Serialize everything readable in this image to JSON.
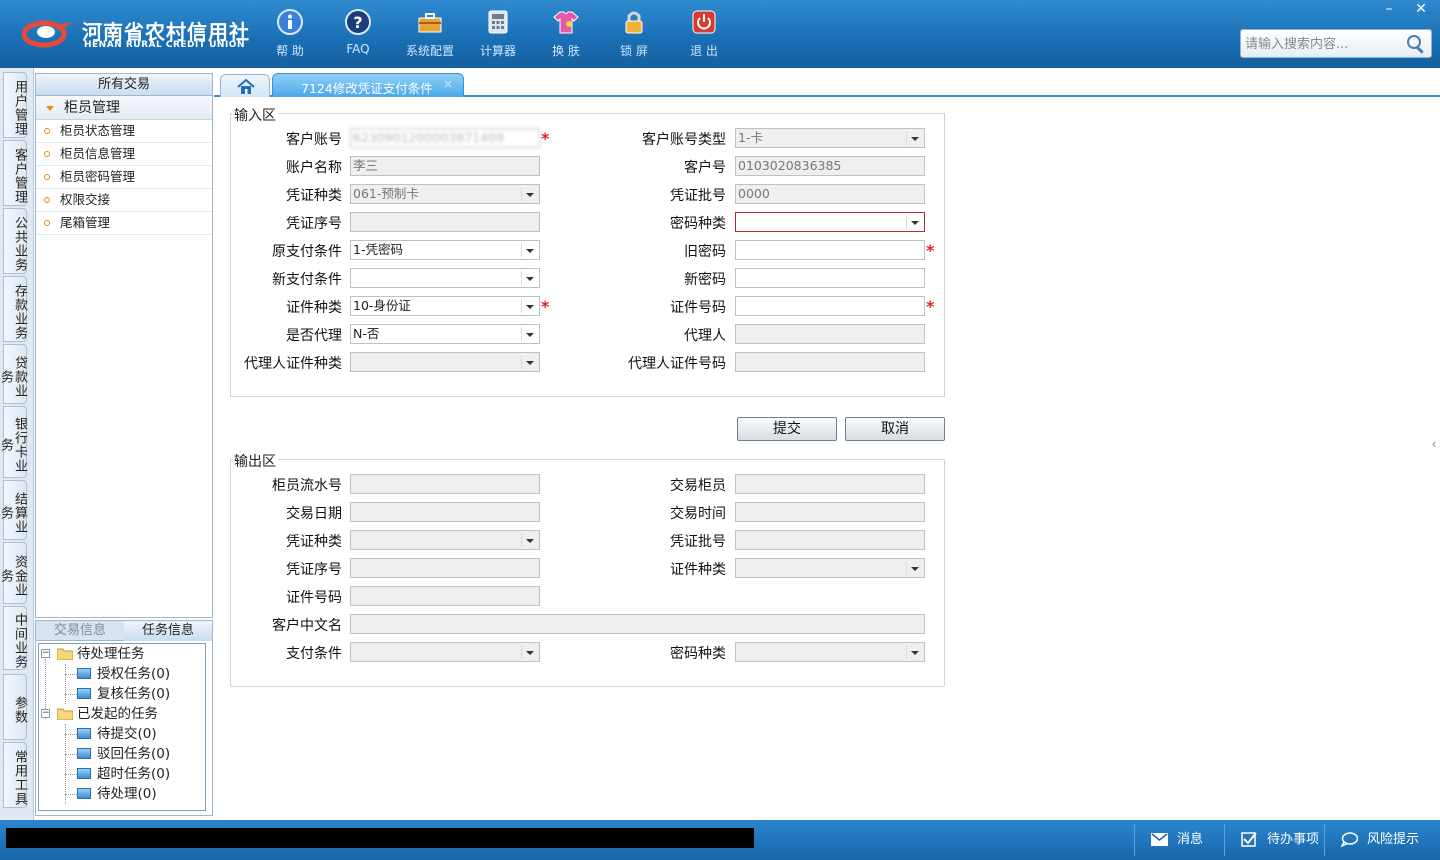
{
  "app": {
    "logo_cn": "河南省农村信用社",
    "logo_en": "HENAN RURAL CREDIT UNION",
    "colors": {
      "header": "#1a6fb4",
      "accent": "#3b8fd5",
      "required": "#d22222",
      "menu_bullet": "#e88a14"
    }
  },
  "toolbar": [
    {
      "label": "帮 助",
      "icon": "info-icon"
    },
    {
      "label": "FAQ",
      "icon": "question-icon"
    },
    {
      "label": "系统配置",
      "icon": "toolbox-icon"
    },
    {
      "label": "计算器",
      "icon": "calculator-icon"
    },
    {
      "label": "换 肤",
      "icon": "shirt-icon"
    },
    {
      "label": "锁 屏",
      "icon": "lock-icon"
    },
    {
      "label": "退 出",
      "icon": "power-icon"
    }
  ],
  "window": {
    "minimize": "–",
    "close": "✕"
  },
  "search": {
    "placeholder": "请输入搜索内容..."
  },
  "categories": [
    "用户管理",
    "客户管理",
    "公共业务",
    "存款业务",
    "贷款业务",
    "银行卡业务",
    "结算业务",
    "资金业务",
    "中间业务",
    "参数",
    "常用工具"
  ],
  "menu": {
    "header": "所有交易",
    "group": "柜员管理",
    "items": [
      "柜员状态管理",
      "柜员信息管理",
      "柜员密码管理",
      "权限交接",
      "尾箱管理"
    ]
  },
  "tasks": {
    "tabs": [
      "交易信息",
      "任务信息"
    ],
    "pending": "待处理任务",
    "pending_children": [
      "授权任务(0)",
      "复核任务(0)"
    ],
    "launched": "已发起的任务",
    "launched_children": [
      "待提交(0)",
      "驳回任务(0)",
      "超时任务(0)",
      "待处理(0)"
    ]
  },
  "tabs": {
    "active": "7124修改凭证支付条件",
    "close": "×"
  },
  "input_area": {
    "legend": "输入区",
    "customer_account": {
      "label": "客户账号",
      "value": "6230901200003871409"
    },
    "account_type": {
      "label": "客户账号类型",
      "value": "1-卡"
    },
    "account_name": {
      "label": "账户名称",
      "value": "李三"
    },
    "customer_no": {
      "label": "客户号",
      "value": "0103020836385"
    },
    "voucher_type": {
      "label": "凭证种类",
      "value": "061-预制卡"
    },
    "voucher_batch": {
      "label": "凭证批号",
      "value": "0000"
    },
    "voucher_seq": {
      "label": "凭证序号",
      "value": ""
    },
    "password_type": {
      "label": "密码种类",
      "value": ""
    },
    "orig_pay_cond": {
      "label": "原支付条件",
      "value": "1-凭密码"
    },
    "old_password": {
      "label": "旧密码",
      "value": ""
    },
    "new_pay_cond": {
      "label": "新支付条件",
      "value": ""
    },
    "new_password": {
      "label": "新密码",
      "value": ""
    },
    "id_type": {
      "label": "证件种类",
      "value": "10-身份证"
    },
    "id_no": {
      "label": "证件号码",
      "value": ""
    },
    "is_agent": {
      "label": "是否代理",
      "value": "N-否"
    },
    "agent": {
      "label": "代理人",
      "value": ""
    },
    "agent_id_type": {
      "label": "代理人证件种类",
      "value": ""
    },
    "agent_id_no": {
      "label": "代理人证件号码",
      "value": ""
    },
    "required_mark": "*"
  },
  "buttons": {
    "submit": "提交",
    "cancel": "取消"
  },
  "output_area": {
    "legend": "输出区",
    "teller_seq": "柜员流水号",
    "txn_teller": "交易柜员",
    "txn_date": "交易日期",
    "txn_time": "交易时间",
    "voucher_type": "凭证种类",
    "voucher_batch": "凭证批号",
    "voucher_seq": "凭证序号",
    "id_type": "证件种类",
    "id_no": "证件号码",
    "cn_name": "客户中文名",
    "pay_cond": "支付条件",
    "password_type": "密码种类"
  },
  "statusbar": {
    "message": "消息",
    "todo": "待办事项",
    "risk": "风险提示"
  }
}
